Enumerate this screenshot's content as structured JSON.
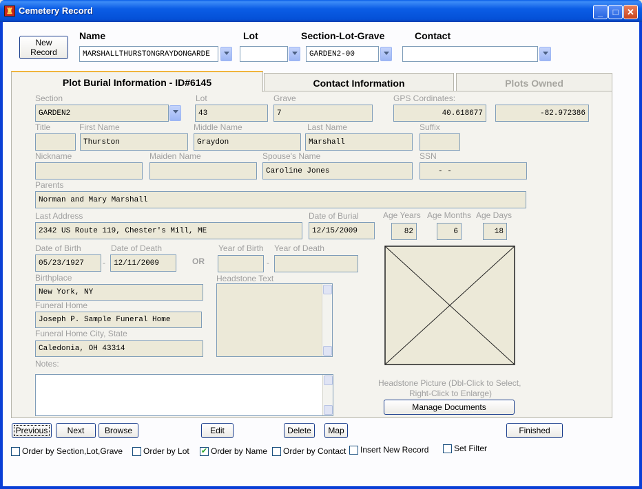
{
  "window": {
    "title": "Cemetery Record",
    "icon": "cemetery-app-icon"
  },
  "top": {
    "new_record": "New Record",
    "name_label": "Name",
    "name_value": "MARSHALLTHURSTONGRAYDONGARDE",
    "lot_label": "Lot",
    "lot_value": "",
    "slg_label": "Section-Lot-Grave",
    "slg_value": "GARDEN2-00",
    "contact_label": "Contact",
    "contact_value": ""
  },
  "tabs": [
    {
      "label": "Plot Burial Information - ID#6145"
    },
    {
      "label": "Contact Information"
    },
    {
      "label": "Plots Owned"
    }
  ],
  "plot": {
    "section_label": "Section",
    "section": "GARDEN2",
    "lot_label": "Lot",
    "lot": "43",
    "grave_label": "Grave",
    "grave": "7",
    "gps_label": "GPS Cordinates:",
    "gps_lat": "40.618677",
    "gps_lon": "-82.972386",
    "title_label": "Title",
    "title": "",
    "first_label": "First Name",
    "first": "Thurston",
    "middle_label": "Middle Name",
    "middle": "Graydon",
    "last_label": "Last Name",
    "last": "Marshall",
    "suffix_label": "Suffix",
    "suffix": "",
    "nickname_label": "Nickname",
    "nickname": "",
    "maiden_label": "Maiden Name",
    "maiden": "",
    "spouse_label": "Spouse's Name",
    "spouse": "Caroline Jones",
    "ssn_label": "SSN",
    "ssn": "-  -",
    "parents_label": "Parents",
    "parents": "Norman and Mary Marshall",
    "address_label": "Last Address",
    "address": "2342 US Route 119, Chester's Mill, ME",
    "burial_label": "Date of Burial",
    "burial": "12/15/2009",
    "age_years_label": "Age Years",
    "age_years": "82",
    "age_months_label": "Age Months",
    "age_months": "6",
    "age_days_label": "Age Days",
    "age_days": "18",
    "dob_label": "Date of Birth",
    "dob": "05/23/1927",
    "dod_label": "Date of Death",
    "dod": "12/11/2009",
    "dash": "-",
    "or": "OR",
    "yob_label": "Year of Birth",
    "yob": "",
    "yod_label": "Year of Death",
    "yod": "",
    "birthplace_label": "Birthplace",
    "birthplace": "New York, NY",
    "headstone_text_label": "Headstone Text",
    "headstone_text": "",
    "funeral_label": "Funeral Home",
    "funeral": "Joseph P. Sample Funeral Home",
    "funeral_city_label": "Funeral Home City, State",
    "funeral_city": "Caledonia, OH 43314",
    "notes_label": "Notes:",
    "notes": "",
    "picture_hint_1": "Headstone Picture (Dbl-Click to Select,",
    "picture_hint_2": "Right-Click to Enlarge)",
    "manage_docs": "Manage Documents"
  },
  "bottom": {
    "previous": "Previous",
    "next": "Next",
    "browse": "Browse",
    "edit": "Edit",
    "delete": "Delete",
    "map": "Map",
    "finished": "Finished",
    "checks": [
      {
        "label": "Order by Section,Lot,Grave",
        "checked": false
      },
      {
        "label": "Order by Lot",
        "checked": false
      },
      {
        "label": "Order by Name",
        "checked": true
      },
      {
        "label": "Order by Contact",
        "checked": false
      },
      {
        "label": "Insert New Record",
        "checked": false
      },
      {
        "label": "Set Filter",
        "checked": false
      }
    ]
  }
}
